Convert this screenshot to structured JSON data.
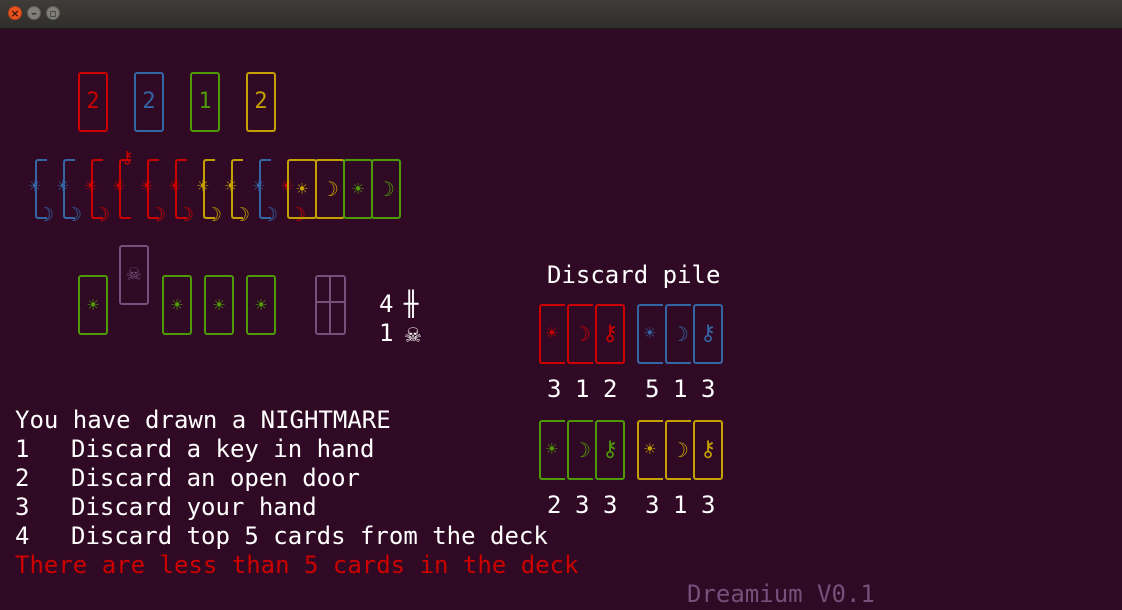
{
  "window": {
    "close_glyph": "×",
    "minimize_glyph": "–",
    "maximize_glyph": "▫"
  },
  "colors": {
    "background": "#300a24",
    "red": "#cc0000",
    "blue": "#3465a4",
    "green": "#4e9a06",
    "yellow": "#c4a000",
    "violet": "#75507b",
    "white": "#ffffff"
  },
  "door_counts": [
    {
      "color": "red",
      "value": "2"
    },
    {
      "color": "blue",
      "value": "2"
    },
    {
      "color": "green",
      "value": "1"
    },
    {
      "color": "yellow",
      "value": "2"
    }
  ],
  "hand_stack": [
    {
      "color": "blue",
      "top": "☀",
      "bottom": "☽"
    },
    {
      "color": "blue",
      "top": "☀",
      "bottom": "☽"
    },
    {
      "color": "red",
      "top": "☀",
      "bottom": "☽"
    },
    {
      "color": "red",
      "top": "☀",
      "bottom": "⚷"
    },
    {
      "color": "red",
      "top": "☀",
      "bottom": "☽"
    },
    {
      "color": "red",
      "top": "☀",
      "bottom": "☽"
    },
    {
      "color": "yellow",
      "top": "☀",
      "bottom": "☽"
    },
    {
      "color": "yellow",
      "top": "☀",
      "bottom": "☽"
    },
    {
      "color": "blue",
      "top": "☀",
      "bottom": "☽"
    },
    {
      "color": "red",
      "top": "☀",
      "bottom": "☽"
    }
  ],
  "hand_open": [
    {
      "color": "yellow",
      "symbol": "☀"
    },
    {
      "color": "yellow",
      "symbol": "☽"
    },
    {
      "color": "green",
      "symbol": "☀"
    },
    {
      "color": "green",
      "symbol": "☽"
    }
  ],
  "labyrinth": [
    {
      "color": "green",
      "symbol": "☀"
    },
    {
      "color": "violet",
      "symbol": "☠"
    },
    {
      "color": "green",
      "symbol": "☀"
    },
    {
      "color": "green",
      "symbol": "☀"
    },
    {
      "color": "green",
      "symbol": "☀"
    }
  ],
  "deck": {
    "count": "4",
    "glyph": "╫",
    "nightmares": "1",
    "nightmare_glyph": "☠"
  },
  "discard": {
    "title": "Discard pile",
    "rows": [
      {
        "groups": [
          {
            "color": "red",
            "cards": [
              {
                "symbol": "☀",
                "count": "3"
              },
              {
                "symbol": "☽",
                "count": "1"
              },
              {
                "symbol": "⚷",
                "count": "2"
              }
            ]
          },
          {
            "color": "blue",
            "cards": [
              {
                "symbol": "☀",
                "count": "5"
              },
              {
                "symbol": "☽",
                "count": "1"
              },
              {
                "symbol": "⚷",
                "count": "3"
              }
            ]
          }
        ]
      },
      {
        "groups": [
          {
            "color": "green",
            "cards": [
              {
                "symbol": "☀",
                "count": "2"
              },
              {
                "symbol": "☽",
                "count": "3"
              },
              {
                "symbol": "⚷",
                "count": "3"
              }
            ]
          },
          {
            "color": "yellow",
            "cards": [
              {
                "symbol": "☀",
                "count": "3"
              },
              {
                "symbol": "☽",
                "count": "1"
              },
              {
                "symbol": "⚷",
                "count": "3"
              }
            ]
          }
        ]
      }
    ]
  },
  "message": {
    "header": "You have drawn a NIGHTMARE",
    "options": [
      {
        "key": "1",
        "text": "Discard a key in hand"
      },
      {
        "key": "2",
        "text": "Discard an open door"
      },
      {
        "key": "3",
        "text": "Discard your hand"
      },
      {
        "key": "4",
        "text": "Discard top 5 cards from the deck"
      }
    ],
    "warning": "There are less than 5 cards in the deck"
  },
  "version": "Dreamium V0.1"
}
